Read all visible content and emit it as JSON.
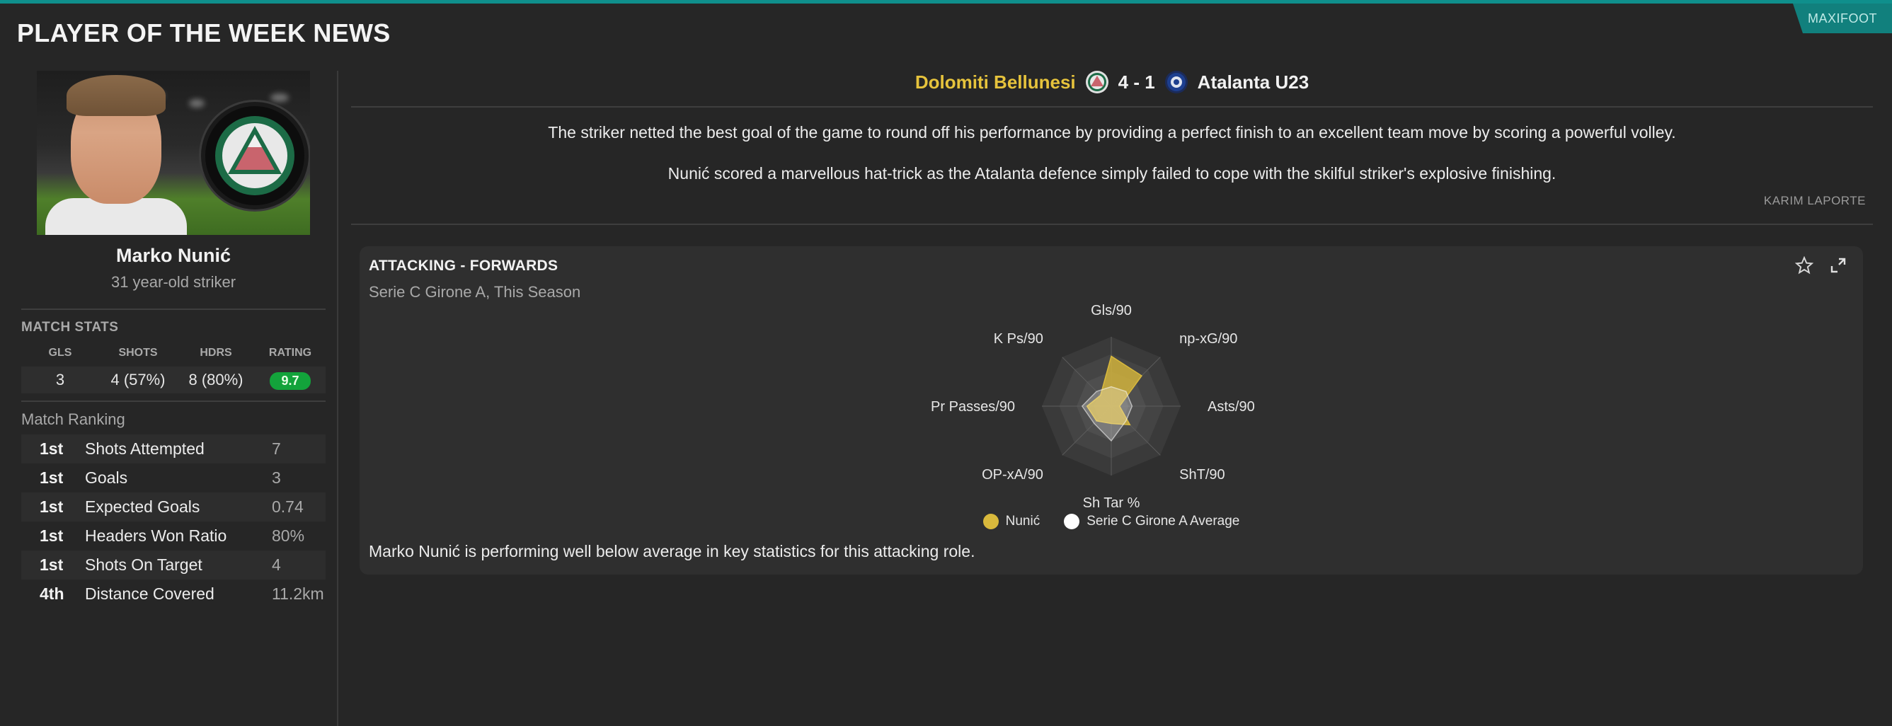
{
  "page_title": "PLAYER OF THE WEEK NEWS",
  "brand": "MAXIFOOT",
  "colors": {
    "accent": "#0f8f8c",
    "home": "#e6c33c",
    "rating": "#13a33b",
    "series_player": "#d9b93c",
    "series_avg": "#ffffff"
  },
  "player": {
    "name": "Marko Nunić",
    "subtitle": "31 year-old striker"
  },
  "match_stats": {
    "title": "MATCH STATS",
    "headers": [
      "GLS",
      "SHOTS",
      "HDRS",
      "RATING"
    ],
    "values": [
      "3",
      "4 (57%)",
      "8 (80%)",
      "9.7"
    ]
  },
  "match_ranking": {
    "title": "Match Ranking",
    "rows": [
      {
        "pos": "1st",
        "label": "Shots Attempted",
        "value": "7"
      },
      {
        "pos": "1st",
        "label": "Goals",
        "value": "3"
      },
      {
        "pos": "1st",
        "label": "Expected Goals",
        "value": "0.74"
      },
      {
        "pos": "1st",
        "label": "Headers Won Ratio",
        "value": "80%"
      },
      {
        "pos": "1st",
        "label": "Shots On Target",
        "value": "4"
      },
      {
        "pos": "4th",
        "label": "Distance Covered",
        "value": "11.2km"
      }
    ]
  },
  "fixture": {
    "home": "Dolomiti Bellunesi",
    "score": "4 - 1",
    "away": "Atalanta U23"
  },
  "report": {
    "p1": "The striker netted the best goal of the game to round off his performance by providing a perfect finish to an excellent team move by scoring a powerful volley.",
    "p2": "Nunić scored a marvellous hat-trick as the Atalanta defence simply failed to cope with the skilful striker's explosive finishing.",
    "author": "KARIM LAPORTE"
  },
  "card": {
    "title": "ATTACKING - FORWARDS",
    "subtitle": "Serie C Girone A, This Season",
    "footer": "Marko Nunić is performing well below average in key statistics for this attacking role.",
    "icons": [
      "star-icon",
      "expand-icon"
    ]
  },
  "chart_data": {
    "type": "radar",
    "axes": [
      "Gls/90",
      "np-xG/90",
      "Asts/90",
      "ShT/90",
      "Sh Tar %",
      "OP-xA/90",
      "Pr Passes/90",
      "K Ps/90"
    ],
    "series": [
      {
        "name": "Nunić",
        "values": [
          0.72,
          0.62,
          0.12,
          0.38,
          0.25,
          0.3,
          0.35,
          0.22
        ]
      },
      {
        "name": "Serie C Girone A Average",
        "values": [
          0.28,
          0.3,
          0.3,
          0.3,
          0.5,
          0.35,
          0.42,
          0.3
        ]
      }
    ],
    "range": [
      0,
      1
    ],
    "legend": "bottom"
  }
}
